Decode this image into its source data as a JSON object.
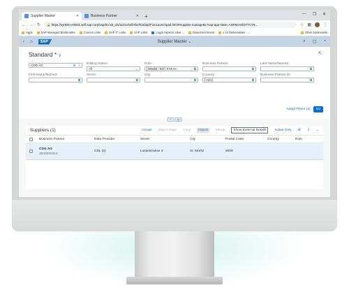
{
  "browser": {
    "tabs": [
      {
        "title": "Supplier Master",
        "active": true
      },
      {
        "title": "Business Partner",
        "active": false
      }
    ],
    "url": "https://syt928-er9001.wdf.sap.corp/sap/bc/ui5_ui5/ui2/ushell/shells/abap/FioriLaunchpad.html#Supplier-manageBc?sap-app-state=ASR9AAGDTTCY9...",
    "bookmarks": [
      "Apps",
      "SAP Managed Bookmarks",
      "Concur Links",
      "SAP IT Links",
      "SAP Links",
      "Legal Aspects User ...",
      "Data Enrichment",
      "1 UI Deliverables - ..."
    ],
    "other_bookmarks": "Other bookmarks"
  },
  "shell": {
    "logo": "SAP",
    "title": "Supplier Master"
  },
  "filterbar": {
    "variant": "Standard *",
    "fields": [
      {
        "label": "",
        "value": "CDG AG",
        "token": "",
        "type": "search"
      },
      {
        "label": "Editing Status:",
        "value": "All",
        "token": "",
        "type": "select"
      },
      {
        "label": "Role:",
        "value": "9 More",
        "token": "Vendor - Intl",
        "type": "multi"
      },
      {
        "label": "Business Partner:",
        "value": "",
        "token": "",
        "type": "vh"
      },
      {
        "label": "Last Name/Name1:",
        "value": "",
        "token": "",
        "type": "vh"
      },
      {
        "label": "First Name/Name2:",
        "value": "",
        "token": "",
        "type": "vh"
      },
      {
        "label": "Street:",
        "value": "",
        "token": "",
        "type": "vh"
      },
      {
        "label": "City:",
        "value": "",
        "token": "",
        "type": "vh"
      },
      {
        "label": "Country:",
        "value": "",
        "token": "~Cn",
        "type": "vh"
      },
      {
        "label": "Business Partner ID:",
        "value": "",
        "token": "",
        "type": "vh"
      }
    ],
    "adapt_filters": "Adapt Filters (3)",
    "go": "Go"
  },
  "table": {
    "title": "Suppliers (1)",
    "toolbar": [
      "Create",
      "Object Page",
      "Copy",
      "Import",
      "Merge",
      "Show External Details",
      "Active Only"
    ],
    "columns": [
      "Business Partner",
      "Data Provider",
      "Street",
      "City",
      "Postal Code",
      "Country",
      "Role"
    ],
    "rows": [
      {
        "name": "CDG AG",
        "id": "3000000316",
        "provider": "CDL (2)",
        "street": "Lukasstrasse 4",
        "city": "St. Moritz",
        "postal": "9008",
        "country": "",
        "role": ""
      }
    ]
  }
}
